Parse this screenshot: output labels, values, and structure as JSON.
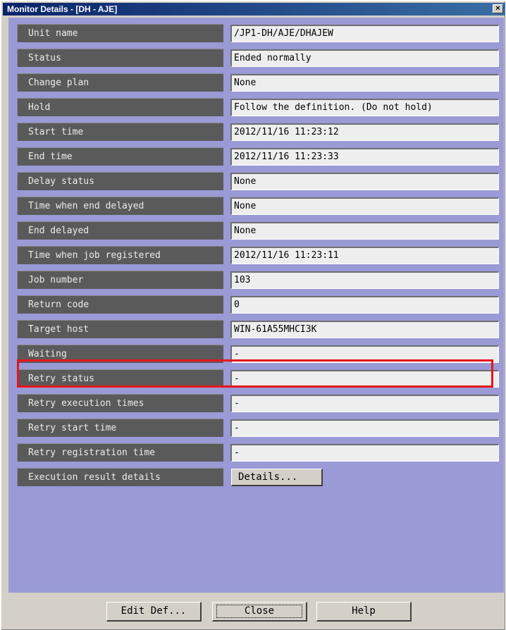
{
  "window": {
    "title": "Monitor Details - [DH - AJE]",
    "close_glyph": "×"
  },
  "fields": [
    {
      "label": "Unit name",
      "value": "/JP1-DH/AJE/DHAJEW"
    },
    {
      "label": "Status",
      "value": "Ended normally"
    },
    {
      "label": "Change plan",
      "value": "None"
    },
    {
      "label": "Hold",
      "value": "Follow the definition. (Do not hold)"
    },
    {
      "label": "Start time",
      "value": "2012/11/16 11:23:12"
    },
    {
      "label": "End time",
      "value": "2012/11/16 11:23:33"
    },
    {
      "label": "Delay status",
      "value": "None"
    },
    {
      "label": "Time when end delayed",
      "value": "None"
    },
    {
      "label": "End delayed",
      "value": "None"
    },
    {
      "label": "Time when job registered",
      "value": "2012/11/16 11:23:11"
    },
    {
      "label": "Job number",
      "value": "103"
    },
    {
      "label": "Return code",
      "value": "0"
    },
    {
      "label": "Target host",
      "value": "WIN-61A55MHCI3K"
    },
    {
      "label": "Waiting",
      "value": "-"
    },
    {
      "label": "Retry status",
      "value": "-"
    },
    {
      "label": "Retry execution times",
      "value": "-"
    },
    {
      "label": "Retry start time",
      "value": "-"
    },
    {
      "label": "Retry registration time",
      "value": "-"
    }
  ],
  "execution_result": {
    "label": "Execution result details",
    "button": "Details..."
  },
  "buttons": {
    "edit_def": "Edit Def...",
    "close": "Close",
    "help": "Help"
  },
  "colors": {
    "highlight": "#e8151c",
    "panel": "#9a9ad6",
    "label_bg": "#5a5a5a"
  }
}
